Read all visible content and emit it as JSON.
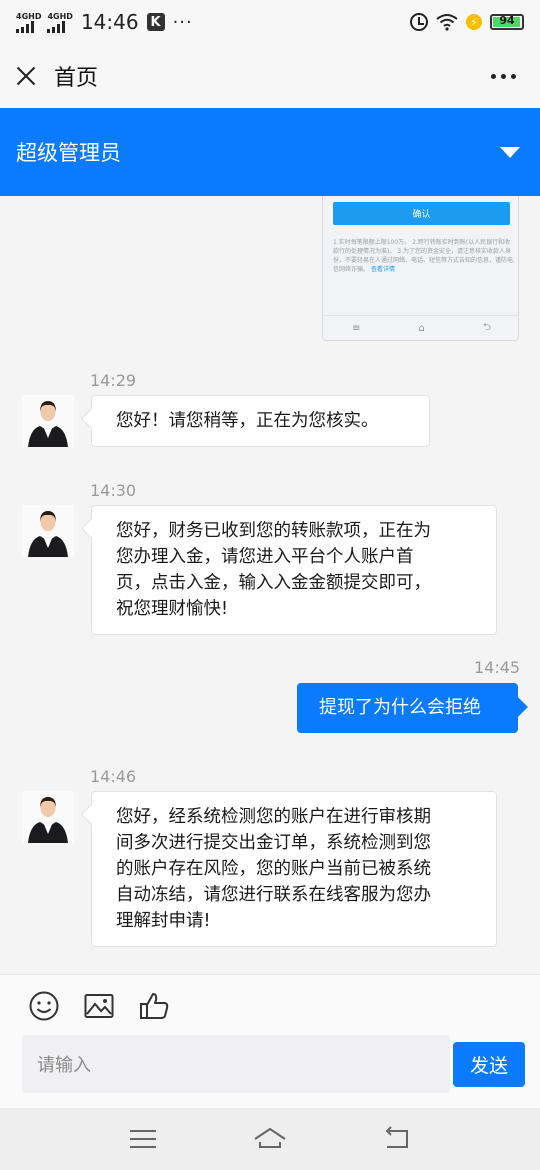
{
  "status_bar": {
    "signal_1_label": "4GHD",
    "signal_2_label": "4GHD",
    "time": "14:46",
    "app_badge": "K",
    "more_dots": "···",
    "battery_level": "94",
    "icons": [
      "signal-icon",
      "alarm-icon",
      "wifi-icon",
      "charging-icon",
      "battery-icon"
    ]
  },
  "header": {
    "title": "首页"
  },
  "user_bar": {
    "name": "超级管理员"
  },
  "embedded_screenshot": {
    "button_label": "确认",
    "notes": "1.实时每笔限额上限100万。 2.跨行转账实时到账(以人民银行和收款行的处理情况为准)。 3.为了您的资金安全，请注意核实收款人身份，不要轻易在人通过网络、电话、短信等方式告知的信息，谨防电信网络诈骗。",
    "link": "查看详情",
    "nav_icons": [
      "≡",
      "⌂",
      "⮌"
    ]
  },
  "messages": [
    {
      "time": "14:29",
      "direction": "in",
      "text": "您好！请您稍等，正在为您核实。"
    },
    {
      "time": "14:30",
      "direction": "in",
      "lines": [
        "您好，财务已收到您的转账款项，正在为",
        "您办理入金，请您进入平台个人账户首",
        "页，点击入金，输入入金金额提交即可，",
        "祝您理财愉快!"
      ]
    },
    {
      "time": "14:45",
      "direction": "out",
      "text": "提现了为什么会拒绝"
    },
    {
      "time": "14:46",
      "direction": "in",
      "lines": [
        "您好，经系统检测您的账户在进行审核期",
        "间多次进行提交出金订单，系统检测到您",
        "的账户存在风险，您的账户当前已被系统",
        "自动冻结，请您进行联系在线客服为您办",
        "理解封申请!"
      ]
    }
  ],
  "composer": {
    "placeholder": "请输入",
    "send_label": "发送"
  },
  "colors": {
    "accent": "#0a7aff",
    "background": "#f4f4f4",
    "bubble_in": "#ffffff"
  }
}
